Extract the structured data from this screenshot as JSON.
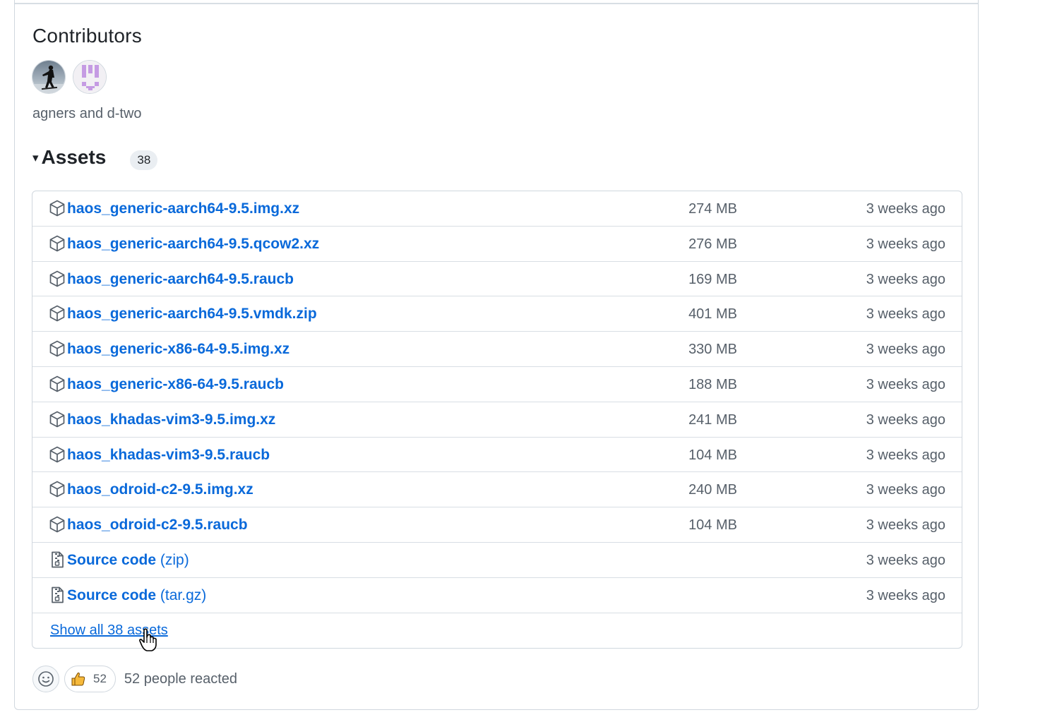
{
  "contributors": {
    "title": "Contributors",
    "avatars": [
      {
        "name": "agners",
        "icon": "avatar-photo"
      },
      {
        "name": "d-two",
        "icon": "avatar-identicon"
      }
    ],
    "names_text": "agners and d-two"
  },
  "assets": {
    "caret": "▾",
    "title": "Assets",
    "count": "38",
    "rows": [
      {
        "name": "haos_generic-aarch64-9.5.img.xz",
        "size": "274 MB",
        "date": "3 weeks ago",
        "icon": "package-icon"
      },
      {
        "name": "haos_generic-aarch64-9.5.qcow2.xz",
        "size": "276 MB",
        "date": "3 weeks ago",
        "icon": "package-icon"
      },
      {
        "name": "haos_generic-aarch64-9.5.raucb",
        "size": "169 MB",
        "date": "3 weeks ago",
        "icon": "package-icon"
      },
      {
        "name": "haos_generic-aarch64-9.5.vmdk.zip",
        "size": "401 MB",
        "date": "3 weeks ago",
        "icon": "package-icon"
      },
      {
        "name": "haos_generic-x86-64-9.5.img.xz",
        "size": "330 MB",
        "date": "3 weeks ago",
        "icon": "package-icon"
      },
      {
        "name": "haos_generic-x86-64-9.5.raucb",
        "size": "188 MB",
        "date": "3 weeks ago",
        "icon": "package-icon"
      },
      {
        "name": "haos_khadas-vim3-9.5.img.xz",
        "size": "241 MB",
        "date": "3 weeks ago",
        "icon": "package-icon"
      },
      {
        "name": "haos_khadas-vim3-9.5.raucb",
        "size": "104 MB",
        "date": "3 weeks ago",
        "icon": "package-icon"
      },
      {
        "name": "haos_odroid-c2-9.5.img.xz",
        "size": "240 MB",
        "date": "3 weeks ago",
        "icon": "package-icon"
      },
      {
        "name": "haos_odroid-c2-9.5.raucb",
        "size": "104 MB",
        "date": "3 weeks ago",
        "icon": "package-icon"
      }
    ],
    "source_rows": [
      {
        "name": "Source code",
        "ext": "(zip)",
        "date": "3 weeks ago",
        "icon": "file-zip-icon"
      },
      {
        "name": "Source code",
        "ext": "(tar.gz)",
        "date": "3 weeks ago",
        "icon": "file-zip-icon"
      }
    ],
    "show_all": "Show all 38 assets"
  },
  "reactions": {
    "emoji_picker_icon": "smiley-icon",
    "thumbs_up_icon": "thumbs-up-icon",
    "thumbs_up_count": "52",
    "summary": "52 people reacted"
  },
  "colors": {
    "link": "#0969da",
    "muted": "#57606a",
    "border": "#d0d7de"
  }
}
